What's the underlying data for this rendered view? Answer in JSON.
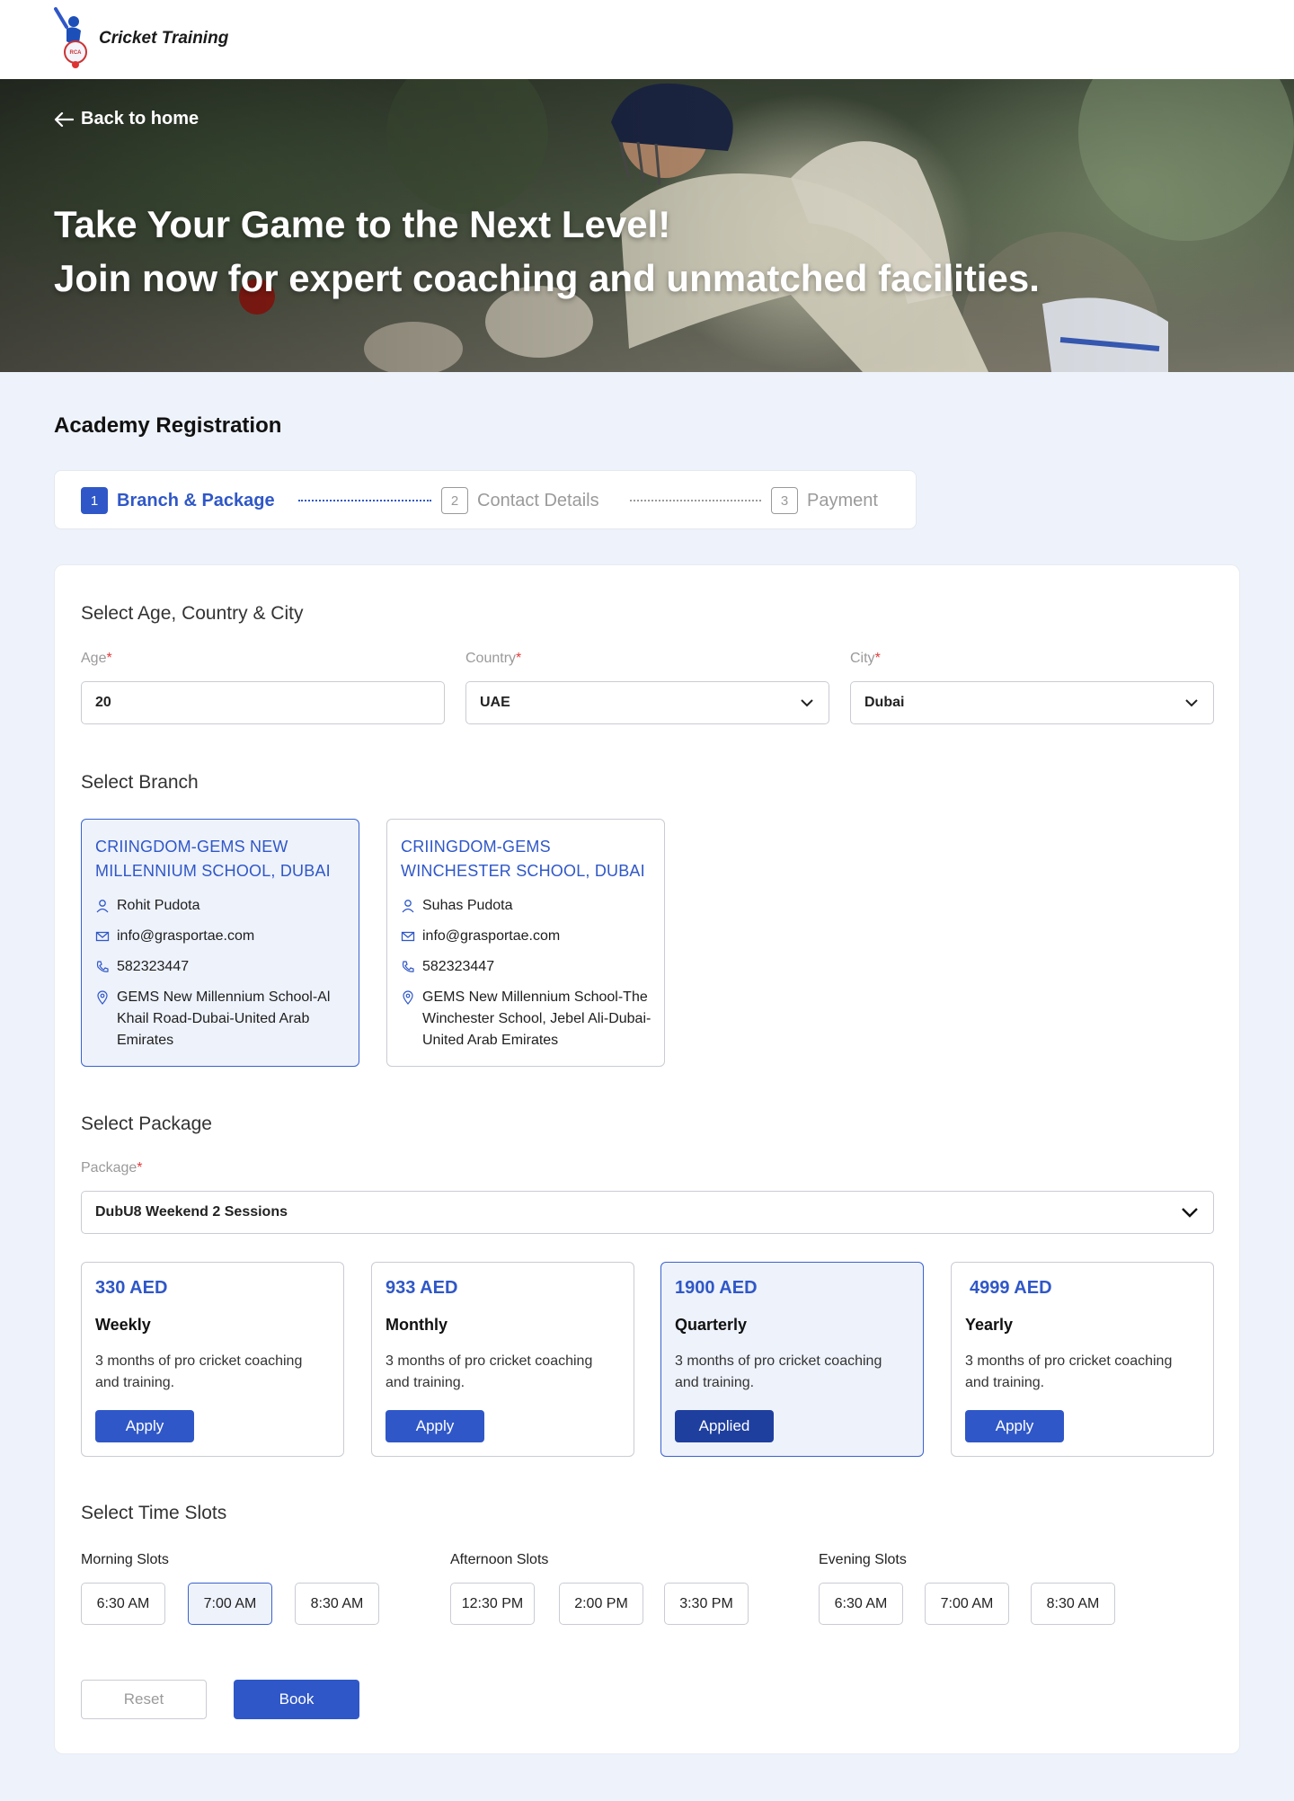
{
  "header": {
    "brand": "Cricket Training"
  },
  "hero": {
    "back_label": "Back to home",
    "title_line1": "Take Your Game to the Next Level!",
    "title_line2": "Join now for expert coaching and unmatched facilities."
  },
  "page_title": "Academy Registration",
  "stepper": {
    "steps": [
      {
        "num": "1",
        "label": "Branch & Package",
        "state": "active"
      },
      {
        "num": "2",
        "label": "Contact Details",
        "state": "inactive"
      },
      {
        "num": "3",
        "label": "Payment",
        "state": "inactive"
      }
    ]
  },
  "location": {
    "section_title": "Select Age, Country & City",
    "age": {
      "label": "Age",
      "value": "20"
    },
    "country": {
      "label": "Country",
      "value": "UAE"
    },
    "city": {
      "label": "City",
      "value": "Dubai"
    }
  },
  "branches": {
    "section_title": "Select Branch",
    "items": [
      {
        "title": "CRIINGDOM-GEMS NEW MILLENNIUM SCHOOL, DUBAI",
        "contact": "Rohit Pudota",
        "email": "info@grasportae.com",
        "phone": "582323447",
        "address": "GEMS New Millennium School-Al Khail Road-Dubai-United Arab Emirates",
        "selected": true
      },
      {
        "title": "CRIINGDOM-GEMS WINCHESTER SCHOOL, DUBAI",
        "contact": "Suhas Pudota",
        "email": "info@grasportae.com",
        "phone": "582323447",
        "address": "GEMS New Millennium School-The Winchester School, Jebel Ali-Dubai-United Arab Emirates",
        "selected": false
      }
    ]
  },
  "package": {
    "section_title": "Select Package",
    "label": "Package",
    "value": "DubU8 Weekend 2 Sessions",
    "plans": [
      {
        "price": "330 AED",
        "name": "Weekly",
        "desc": "3 months of pro cricket coaching and training.",
        "button": "Apply"
      },
      {
        "price": "933 AED",
        "name": "Monthly",
        "desc": "3 months of pro cricket coaching and training.",
        "button": "Apply"
      },
      {
        "price": "1900 AED",
        "name": "Quarterly",
        "desc": "3 months of pro cricket coaching and training.",
        "button": "Applied"
      },
      {
        "price": "4999 AED",
        "name": "Yearly",
        "desc": "3 months of pro cricket coaching and training.",
        "button": "Apply"
      }
    ]
  },
  "slots": {
    "section_title": "Select Time Slots",
    "morning": {
      "label": "Morning Slots",
      "times": [
        "6:30 AM",
        "7:00 AM",
        "8:30 AM"
      ]
    },
    "afternoon": {
      "label": "Afternoon Slots",
      "times": [
        "12:30 PM",
        "2:00 PM",
        "3:30 PM"
      ]
    },
    "evening": {
      "label": "Evening Slots",
      "times": [
        "6:30 AM",
        "7:00 AM",
        "8:30 AM"
      ]
    },
    "selected": "7:00 AM"
  },
  "actions": {
    "reset": "Reset",
    "book": "Book"
  },
  "colors": {
    "accent": "#2f57c8",
    "selected_bg": "#eef2fb",
    "page_bg": "#eef2fa",
    "required": "#e23b3b"
  }
}
